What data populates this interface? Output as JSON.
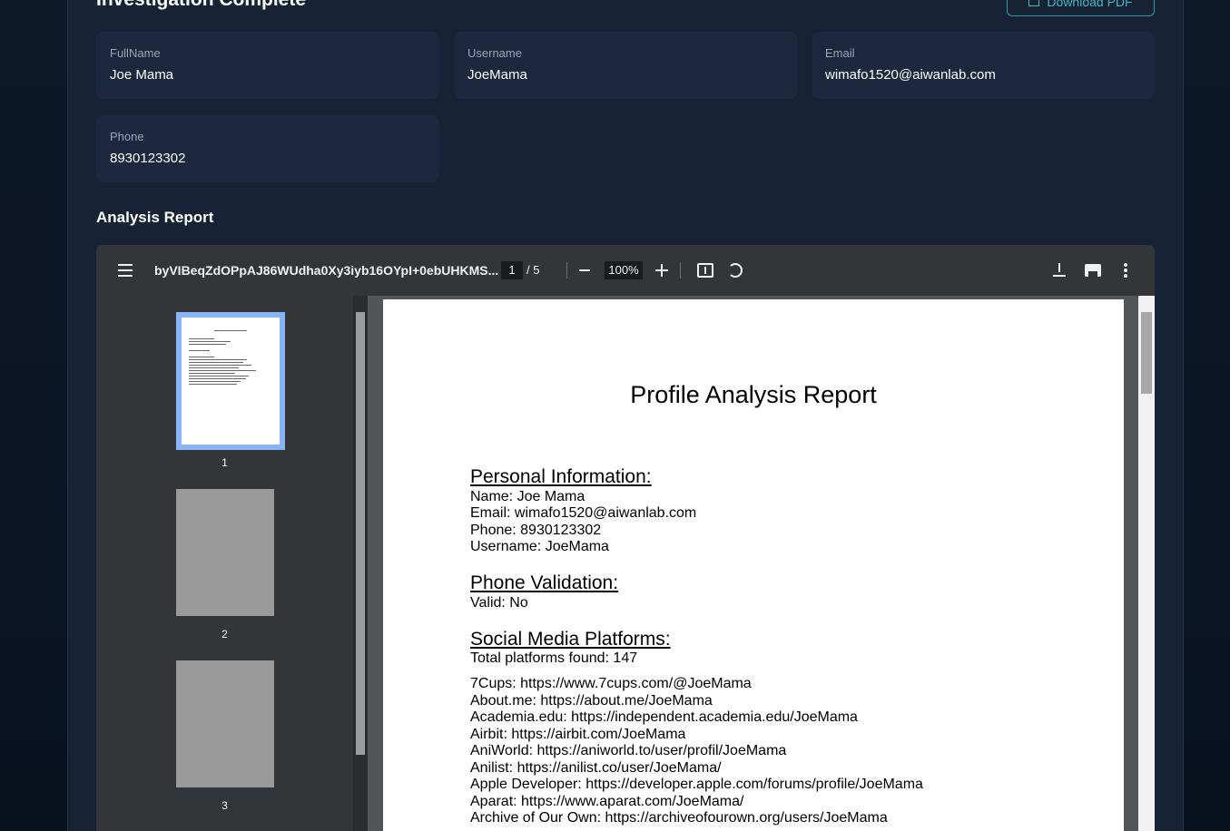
{
  "header": {
    "title": "Investigation Complete",
    "download_label": "Download PDF"
  },
  "fields": [
    {
      "label": "FullName",
      "value": "Joe Mama"
    },
    {
      "label": "Username",
      "value": "JoeMama"
    },
    {
      "label": "Email",
      "value": "wimafo1520@aiwanlab.com"
    },
    {
      "label": "Phone",
      "value": "8930123302"
    }
  ],
  "report": {
    "section_title": "Analysis Report",
    "viewer": {
      "filename": "byVIBeqZdOPpAJ86WUdha0Xy3iyb16OYpI+0ebUHKMS...",
      "current_page": "1",
      "total_pages": "/ 5",
      "zoom": "100%",
      "thumbnails": [
        "1",
        "2",
        "3"
      ]
    },
    "pdf": {
      "title": "Profile Analysis Report",
      "personal_heading": "Personal Information:",
      "personal_lines": [
        "Name: Joe Mama",
        "Email: wimafo1520@aiwanlab.com",
        "Phone: 8930123302",
        "Username: JoeMama"
      ],
      "phone_heading": "Phone Validation:",
      "phone_line": "Valid: No",
      "social_heading": "Social Media Platforms:",
      "social_total": "Total platforms found: 147",
      "platforms": [
        "7Cups: https://www.7cups.com/@JoeMama",
        "About.me: https://about.me/JoeMama",
        "Academia.edu: https://independent.academia.edu/JoeMama",
        "Airbit: https://airbit.com/JoeMama",
        "AniWorld: https://aniworld.to/user/profil/JoeMama",
        "Anilist: https://anilist.co/user/JoeMama/",
        "Apple Developer: https://developer.apple.com/forums/profile/JoeMama",
        "Aparat: https://www.aparat.com/JoeMama/",
        "Archive of Our Own: https://archiveofourown.org/users/JoeMama"
      ]
    }
  }
}
